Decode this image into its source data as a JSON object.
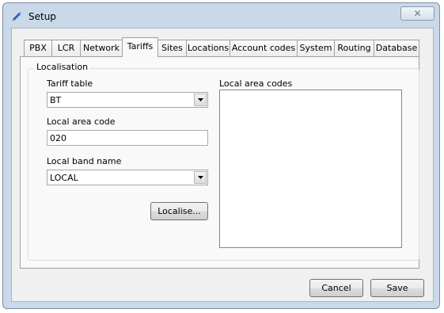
{
  "window": {
    "title": "Setup",
    "close_glyph": "✕"
  },
  "tabs": [
    {
      "label": "PBX"
    },
    {
      "label": "LCR"
    },
    {
      "label": "Network"
    },
    {
      "label": "Tariffs",
      "selected": true
    },
    {
      "label": "Sites"
    },
    {
      "label": "Locations"
    },
    {
      "label": "Account codes"
    },
    {
      "label": "System"
    },
    {
      "label": "Routing"
    },
    {
      "label": "Database"
    }
  ],
  "localisation": {
    "group_label": "Localisation",
    "tariff_table": {
      "label": "Tariff table",
      "value": "BT"
    },
    "local_area_code": {
      "label": "Local area code",
      "value": "020"
    },
    "local_band_name": {
      "label": "Local band name",
      "value": "LOCAL"
    },
    "localise_button": "Localise...",
    "local_area_codes": {
      "label": "Local area codes",
      "items": []
    }
  },
  "footer": {
    "cancel": "Cancel",
    "save": "Save"
  },
  "colors": {
    "frame": "#c9d9ea",
    "client": "#f0f0f0",
    "panel": "#f9f9f9",
    "pencil_icon": "#2f5fb8"
  }
}
